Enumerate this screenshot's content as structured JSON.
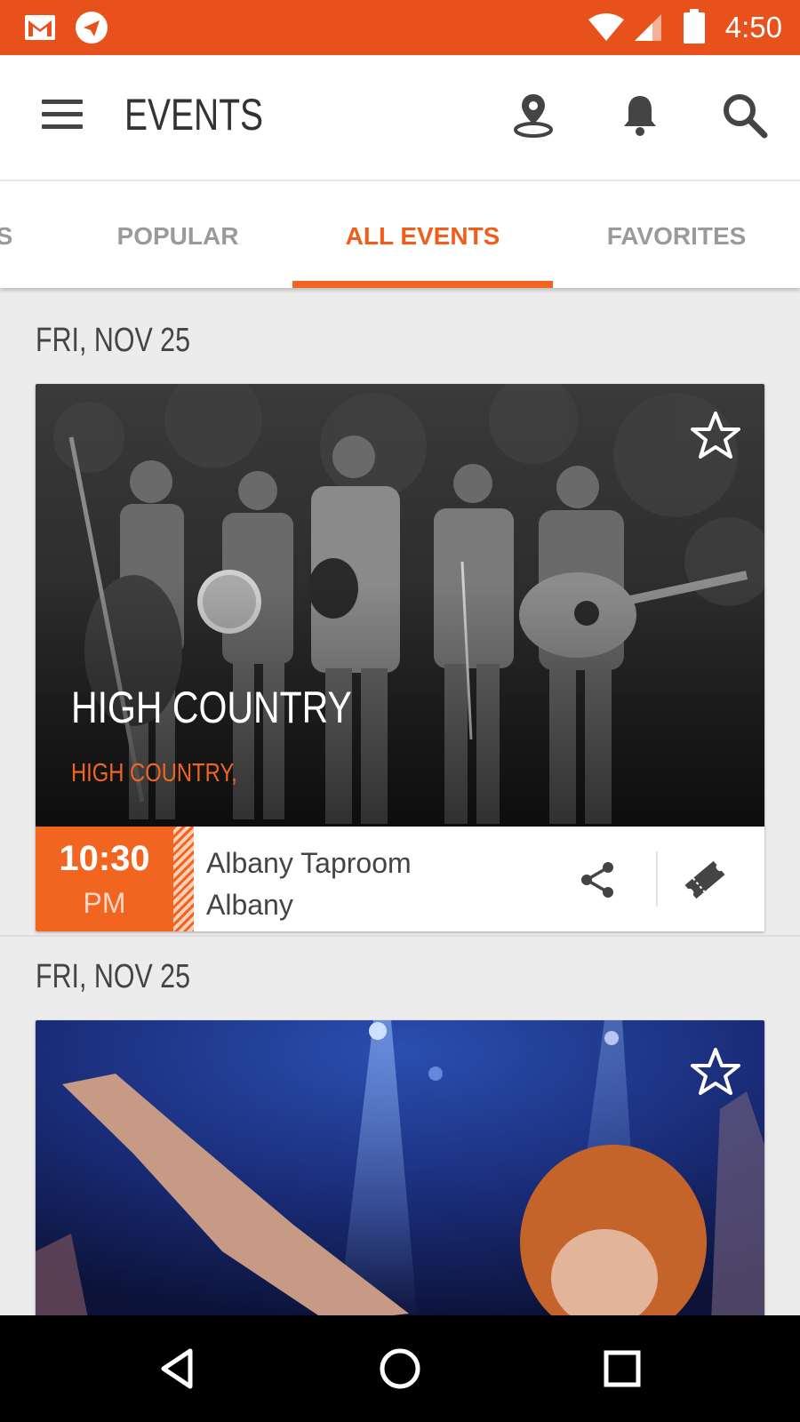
{
  "status_bar": {
    "time": "4:50"
  },
  "app_bar": {
    "title": "EVENTS"
  },
  "tabs": [
    {
      "label": "S"
    },
    {
      "label": "POPULAR"
    },
    {
      "label": "ALL EVENTS",
      "active": true
    },
    {
      "label": "FAVORITES"
    }
  ],
  "events": [
    {
      "date": "FRI, NOV 25",
      "title": "HIGH COUNTRY",
      "subtitle": "HIGH COUNTRY,",
      "time": "10:30",
      "ampm": "PM",
      "venue": "Albany Taproom",
      "city": "Albany",
      "favorited": false
    },
    {
      "date": "FRI, NOV 25",
      "favorited": false
    }
  ],
  "colors": {
    "status_bar": "#e8501c",
    "accent": "#f26521",
    "tab_inactive": "#9a9a9a",
    "background": "#ececec"
  }
}
